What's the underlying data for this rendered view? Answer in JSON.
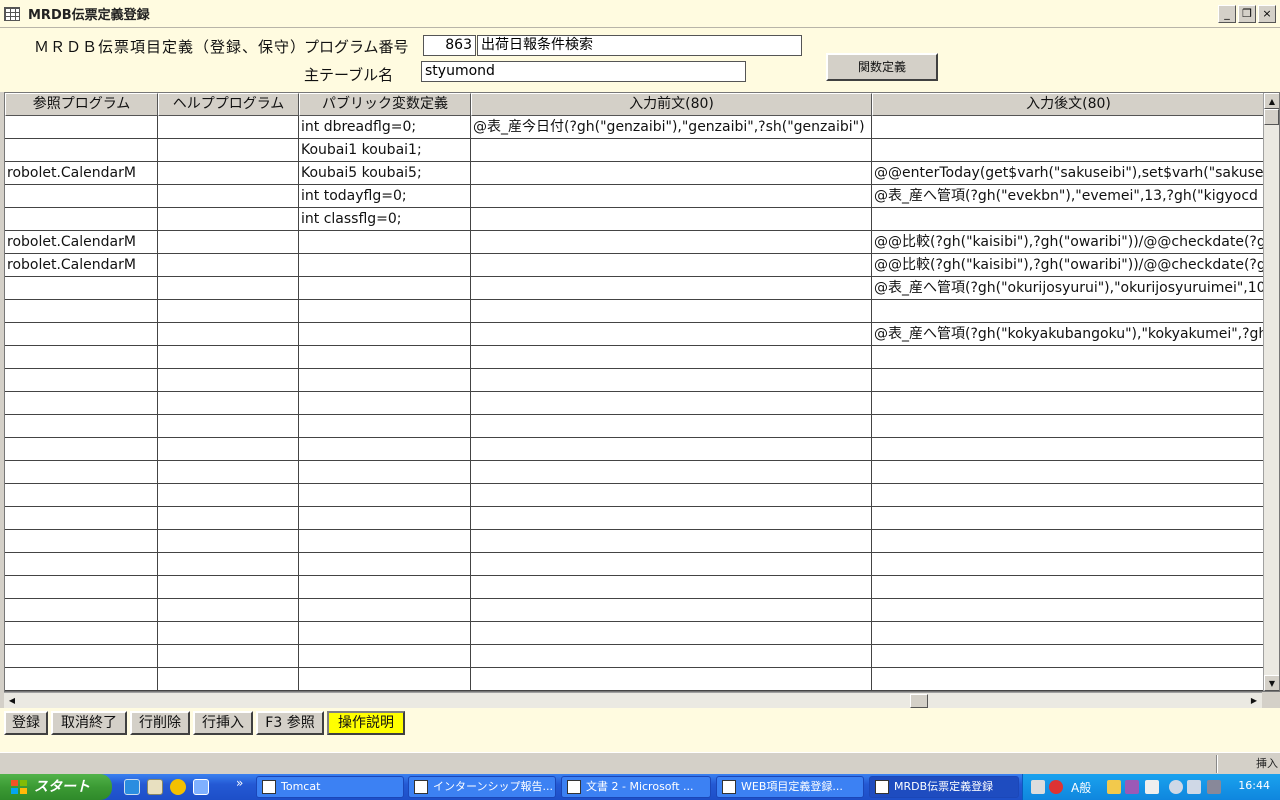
{
  "window": {
    "title": "MRDB伝票定義登録",
    "minimize": "_",
    "maximize": "❐",
    "close": "×"
  },
  "form": {
    "title": "ＭＲＤＢ伝票項目定義（登録、保守）",
    "program_no_label": "プログラム番号",
    "program_no_value": "863",
    "program_name_value": "出荷日報条件検索",
    "main_table_label": "主テーブル名",
    "main_table_value": "styumond",
    "function_def_button": "関数定義"
  },
  "grid": {
    "columns": [
      "参照プログラム",
      "ヘルププログラム",
      "パブリック変数定義",
      "入力前文(80)",
      "入力後文(80)"
    ],
    "rows": [
      [
        "",
        "",
        "int dbreadflg=0;",
        "@表_産今日付(?gh(\"genzaibi\"),\"genzaibi\",?sh(\"genzaibi\")",
        ""
      ],
      [
        "",
        "",
        "Koubai1 koubai1;",
        "",
        ""
      ],
      [
        "robolet.CalendarM",
        "",
        "Koubai5 koubai5;",
        "",
        "@@enterToday(get$varh(\"sakuseibi\"),set$varh(\"sakuseibi"
      ],
      [
        "",
        "",
        "int todayflg=0;",
        "",
        "@表_産へ管項(?gh(\"evekbn\"),\"evemei\",13,?gh(\"kigyocd"
      ],
      [
        "",
        "",
        "int classflg=0;",
        "",
        ""
      ],
      [
        "robolet.CalendarM",
        "",
        "",
        "",
        "@@比較(?gh(\"kaisibi\"),?gh(\"owaribi\"))/@@checkdate(?gh"
      ],
      [
        "robolet.CalendarM",
        "",
        "",
        "",
        "@@比較(?gh(\"kaisibi\"),?gh(\"owaribi\"))/@@checkdate(?gh"
      ],
      [
        "",
        "",
        "",
        "",
        "@表_産へ管項(?gh(\"okurijosyurui\"),\"okurijosyuruimei\",10"
      ],
      [
        "",
        "",
        "",
        "",
        ""
      ],
      [
        "",
        "",
        "",
        "",
        "@表_産へ管項(?gh(\"kokyakubangoku\"),\"kokyakumei\",?gh"
      ]
    ]
  },
  "toolbar": {
    "buttons": [
      "登録",
      "取消終了",
      "行削除",
      "行挿入",
      "F3 参照",
      "操作説明"
    ]
  },
  "statusbar": {
    "mode": "挿入"
  },
  "taskbar": {
    "start": "スタート",
    "chevron": "»",
    "tasks": [
      "Tomcat",
      "インターンシップ報告...",
      "文書 2 - Microsoft ...",
      "WEB項目定義登録...",
      "MRDB伝票定義登録"
    ],
    "ime": "A般",
    "clock": "16:44"
  }
}
